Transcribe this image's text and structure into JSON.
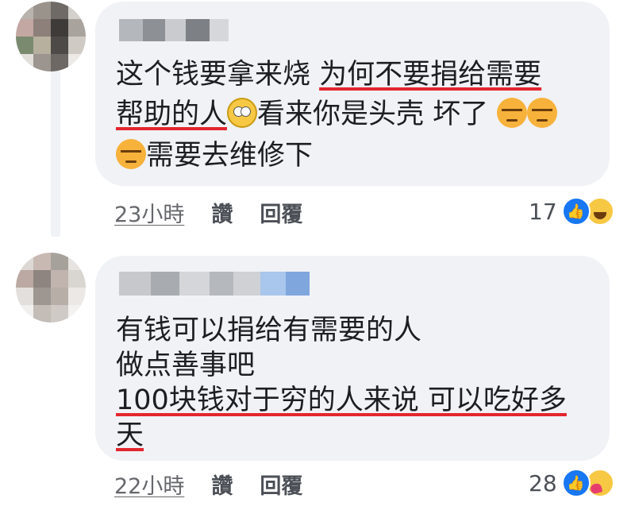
{
  "comments": [
    {
      "lines": [
        {
          "plain": "这个钱要拿来烧 ",
          "underlined": "为何不要捐给需要"
        },
        {
          "underlined": "帮助的人",
          "after_emoji": "看来你是头壳 坏了"
        },
        {
          "text": "需要去维修下"
        }
      ],
      "timestamp": "23小時",
      "like_label": "讚",
      "reply_label": "回覆",
      "reaction_count": "17",
      "reactions": [
        "like-icon",
        "haha-icon"
      ]
    },
    {
      "lines": [
        {
          "text": "有钱可以捐给有需要的人"
        },
        {
          "text": "做点善事吧"
        },
        {
          "underlined": "100块钱对于穷的人来说 可以吃好多"
        },
        {
          "underlined": "天"
        }
      ],
      "timestamp": "22小時",
      "like_label": "讚",
      "reply_label": "回覆",
      "reaction_count": "28",
      "reactions": [
        "like-icon",
        "care-icon"
      ]
    }
  ],
  "colors": {
    "bubble": "#f0f2f5",
    "underline": "#e3262f",
    "like": "#1877f2",
    "text": "#1c1e21"
  }
}
